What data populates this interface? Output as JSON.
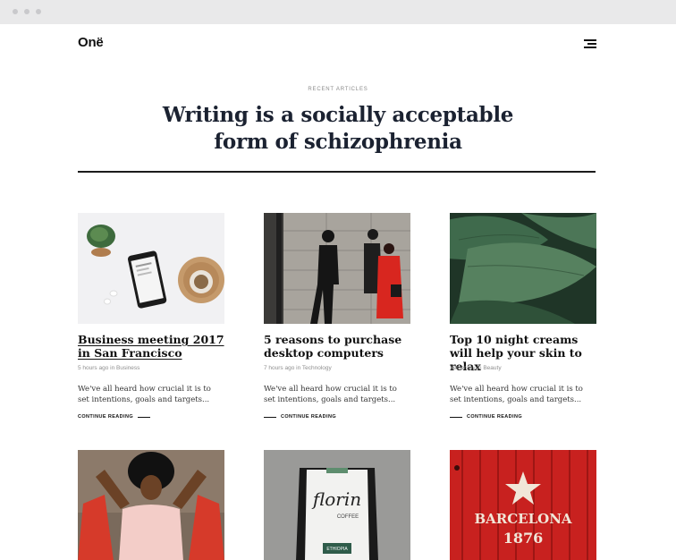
{
  "site": {
    "logo": "Onë"
  },
  "hero": {
    "eyebrow": "RECENT ARTICLES",
    "title": "Writing is a socially acceptable form of schizophrenia"
  },
  "articles": [
    {
      "title": "Business meeting 2017 in San Francisco",
      "meta": "5 hours ago in Business",
      "excerpt": "We've all heard how crucial it is to set intentions, goals and targets...",
      "read_more": "CONTINUE READING",
      "image": "desk-with-phone-plant-coffee"
    },
    {
      "title": "5 reasons to purchase desktop computers",
      "meta": "7 hours ago in Technology",
      "excerpt": "We've all heard how crucial it is to set intentions, goals and targets...",
      "read_more": "CONTINUE READING",
      "image": "people-silhouettes-street"
    },
    {
      "title": "Top 10 night creams will help your skin to relax",
      "meta": "Yesterday in Beauty",
      "excerpt": "We've all heard how crucial it is to set intentions, goals and targets...",
      "read_more": "CONTINUE READING",
      "image": "green-leaves"
    }
  ],
  "second_row": [
    {
      "image": "woman-red-chair"
    },
    {
      "image": "florin-coffee-bag",
      "bag_text": "florin",
      "bag_subtext": "COFFEE",
      "bag_label": "ETHIOPIA"
    },
    {
      "image": "barcelona-red-wall",
      "sign_line1": "BARCELONA",
      "sign_line2": "1876"
    }
  ],
  "colors": {
    "title": "#1b2231",
    "browser_bar": "#e9e9ea"
  }
}
